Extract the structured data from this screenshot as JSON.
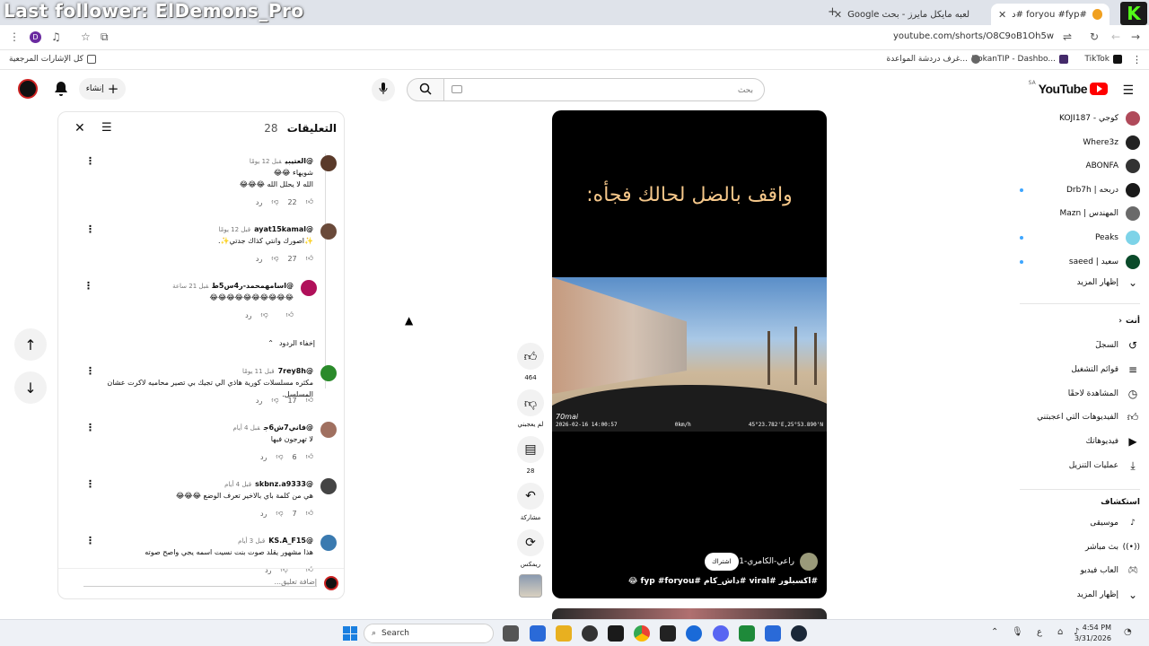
{
  "overlay": {
    "last_follower": "Last follower: ElDemons_Pro"
  },
  "browser": {
    "tabs": [
      {
        "label": "#foryou #fyp #داش_كام 😂"
      },
      {
        "label": "لعبه مايكل مايرز - بحث Google"
      }
    ],
    "url": "youtube.com/shorts/O8C9oB1Oh5w",
    "profile_letter": "D",
    "bookmarks": {
      "all_bookmarks": "كل الإشارات المرجعية",
      "items": [
        "TikTok",
        "DokanTIP - Dashbo...",
        "غرف دردشة المواعدة..."
      ]
    }
  },
  "header": {
    "logo_text": "YouTube",
    "region": "SA",
    "search_placeholder": "بحث",
    "create_label": "إنشاء"
  },
  "sidebar": {
    "subscriptions": [
      {
        "label": "كوجي - KOJI187",
        "color": "#b04a5a",
        "new": false
      },
      {
        "label": "Where3z",
        "color": "#222222",
        "new": false
      },
      {
        "label": "ABONFA",
        "color": "#333333",
        "new": false
      },
      {
        "label": "دربحه | Drb7h",
        "color": "#1a1a1a",
        "new": true
      },
      {
        "label": "المهندس | Mazn",
        "color": "#6a6a6a",
        "new": false
      },
      {
        "label": "Peaks",
        "color": "#7dd3e8",
        "new": true
      },
      {
        "label": "سعيد | saeed",
        "color": "#0a4a2a",
        "new": true
      }
    ],
    "show_more_1": "إظهار المزيد",
    "you_section": "أنت",
    "you_items": [
      {
        "label": "السجلّ",
        "icon": "history-icon"
      },
      {
        "label": "قوائم التشغيل",
        "icon": "playlist-icon"
      },
      {
        "label": "المشاهدة لاحقًا",
        "icon": "clock-icon"
      },
      {
        "label": "الفيديوهات التي أعجبتني",
        "icon": "like-icon"
      },
      {
        "label": "فيديوهاتك",
        "icon": "video-icon"
      },
      {
        "label": "عمليات التنزيل",
        "icon": "download-icon"
      }
    ],
    "explore_section": "استكشاف",
    "explore_items": [
      {
        "label": "موسيقى",
        "icon": "music-icon"
      },
      {
        "label": "بث مباشر",
        "icon": "live-icon"
      },
      {
        "label": "ألعاب فيديو",
        "icon": "gaming-icon"
      }
    ],
    "show_more_2": "إظهار المزيد"
  },
  "short": {
    "overlay_title": "واقف بالضل لحالك فجأه:",
    "dashcam_brand": "70mai",
    "dashcam_time": "2026-02-16 14:00:57",
    "dashcam_speed": "0km/h",
    "dashcam_coords": "45°23.782'E,25°53.890'N",
    "channel": "@راعي-الكامري-1",
    "subscribe_label": "اشتراك",
    "tags": "#اكسبلور #viral #داش_كام #fyp #foryou 😂"
  },
  "actions": {
    "likes": "464",
    "dislike_label": "لم يعجبني",
    "comments": "28",
    "share_label": "مشاركة",
    "remix_label": "ريمكس"
  },
  "comments_panel": {
    "title": "التعليقات",
    "count": "28",
    "reply_label": "رد",
    "hide_replies": "إخفاء الردود",
    "add_placeholder": "إضافة تعليق...",
    "items": [
      {
        "handle": "@العتيبي",
        "time": "قبل 12 يومًا",
        "text": "شويهاء 😂😂\nالله لا يحلل الله 😂😂😂",
        "likes": "22",
        "color": "#5a3a2a"
      },
      {
        "handle": "@ayat15kamal",
        "time": "قبل 12 يومًا",
        "text": "✨اصورك وانتي كذاك جدتي✨.",
        "likes": "27",
        "color": "#6a4a3a"
      },
      {
        "handle": "@اسامهمحمد-ر4س5ط",
        "time": "قبل 21 ساعة",
        "text": "😂😂😂😂😂😂😂😂😂😂",
        "likes": "",
        "color": "#b0105a"
      },
      {
        "handle": "@7rey8h",
        "time": "قبل 11 يومًا",
        "text": "مكثره مسلسلات كورية هاذي الي تجيك بي تصير محاميه لاكرت عشان المسلسل.",
        "likes": "17",
        "color": "#2a8a2a"
      },
      {
        "handle": "@فاني7ش6ج",
        "time": "قبل 4 أيام",
        "text": "لا تهرجون فيها",
        "likes": "6",
        "color": "#a07060"
      },
      {
        "handle": "@skbnz.a9333",
        "time": "قبل 4 أيام",
        "text": "هي من كلمة باي بالاخير تعرف الوضع 😂😂😂",
        "likes": "7",
        "color": "#444444"
      },
      {
        "handle": "@KS.A_F15",
        "time": "قبل 3 أيام",
        "text": "هذا مشهور  يقلد صوت بنت نسيت اسمه يجي واصح صوته",
        "likes": "",
        "color": "#3a7ab0"
      }
    ]
  },
  "taskbar": {
    "search": "Search",
    "time": "4:54 PM",
    "date": "3/31/2026"
  }
}
